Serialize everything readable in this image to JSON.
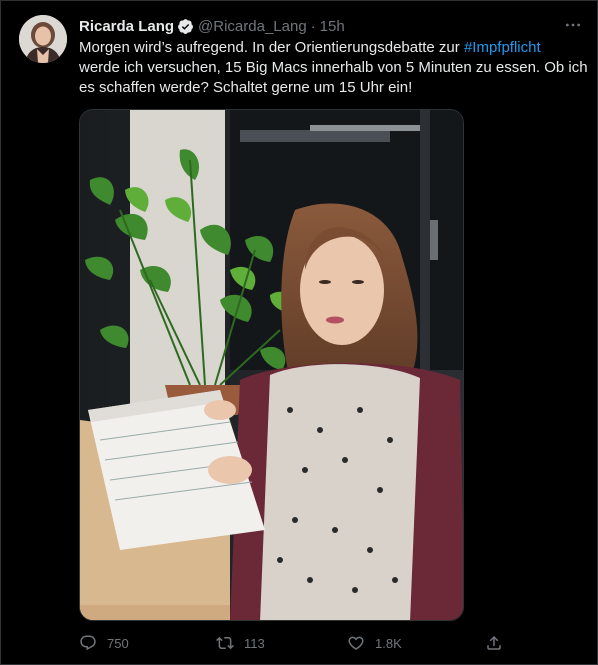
{
  "tweet": {
    "author_name": "Ricarda Lang",
    "author_handle": "@Ricarda_Lang",
    "separator": "·",
    "time": "15h",
    "text_line1": "Morgen wird’s aufregend. In der Orientierungsdebatte zur ",
    "hashtag": "#Impfpflicht",
    "text_line2": "werde ich versuchen, 15 Big Macs innerhalb von 5 Minuten zu essen. Ob ich",
    "text_line3": "es schaffen werde? Schaltet gerne um 15 Uhr ein!"
  },
  "actions": {
    "reply_count": "750",
    "retweet_count": "113",
    "like_count": "1.8K"
  },
  "icons": {
    "verified": "verified-badge-icon",
    "more": "more-icon",
    "reply": "reply-icon",
    "retweet": "retweet-icon",
    "like": "like-icon",
    "share": "share-icon"
  },
  "colors": {
    "background": "#000000",
    "text": "#e7e9ea",
    "secondary": "#71767b",
    "link": "#1d9bf0",
    "border": "#2f3336"
  }
}
